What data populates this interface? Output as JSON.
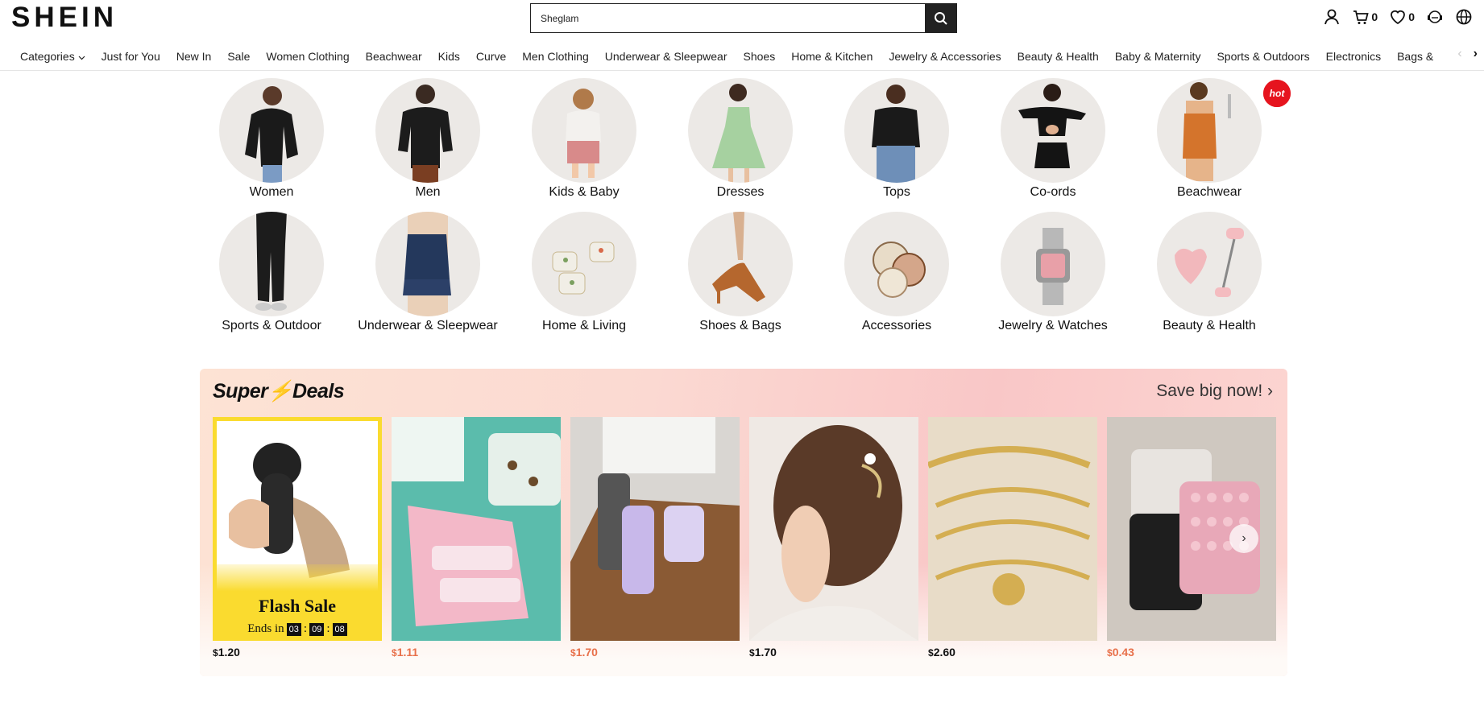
{
  "header": {
    "logo": "SHEIN",
    "search_value": "Sheglam",
    "cart_count": "0",
    "wishlist_count": "0"
  },
  "nav": {
    "items": [
      "Categories",
      "Just for You",
      "New In",
      "Sale",
      "Women Clothing",
      "Beachwear",
      "Kids",
      "Curve",
      "Men Clothing",
      "Underwear & Sleepwear",
      "Shoes",
      "Home & Kitchen",
      "Jewelry & Accessories",
      "Beauty & Health",
      "Baby & Maternity",
      "Sports & Outdoors",
      "Electronics",
      "Bags & Luggage"
    ]
  },
  "categories": {
    "row1": [
      {
        "label": "Women",
        "hot": false
      },
      {
        "label": "Men",
        "hot": false
      },
      {
        "label": "Kids & Baby",
        "hot": false
      },
      {
        "label": "Dresses",
        "hot": true
      },
      {
        "label": "Tops",
        "hot": false
      },
      {
        "label": "Co-ords",
        "hot": true
      },
      {
        "label": "Beachwear",
        "hot": false
      }
    ],
    "row2": [
      {
        "label": "Sports & Outdoor"
      },
      {
        "label": "Underwear & Sleepwear"
      },
      {
        "label": "Home & Living"
      },
      {
        "label": "Shoes & Bags"
      },
      {
        "label": "Accessories"
      },
      {
        "label": "Jewelry & Watches"
      },
      {
        "label": "Beauty & Health"
      }
    ],
    "hot_label": "hot"
  },
  "super_deals": {
    "title_a": "Super",
    "title_b": "Deals",
    "save_link": "Save big now!",
    "flash": {
      "title": "Flash Sale",
      "ends_label": "Ends in",
      "hh": "03",
      "mm": "09",
      "ss": "08"
    },
    "products": [
      {
        "currency": "$",
        "price": "1.20",
        "color": "#111111"
      },
      {
        "currency": "$",
        "price": "1.11",
        "color": "#e8704a"
      },
      {
        "currency": "$",
        "price": "1.70",
        "color": "#e8704a"
      },
      {
        "currency": "$",
        "price": "1.70",
        "color": "#111111"
      },
      {
        "currency": "$",
        "price": "2.60",
        "color": "#111111"
      },
      {
        "currency": "$",
        "price": "0.43",
        "color": "#e8704a"
      }
    ]
  }
}
